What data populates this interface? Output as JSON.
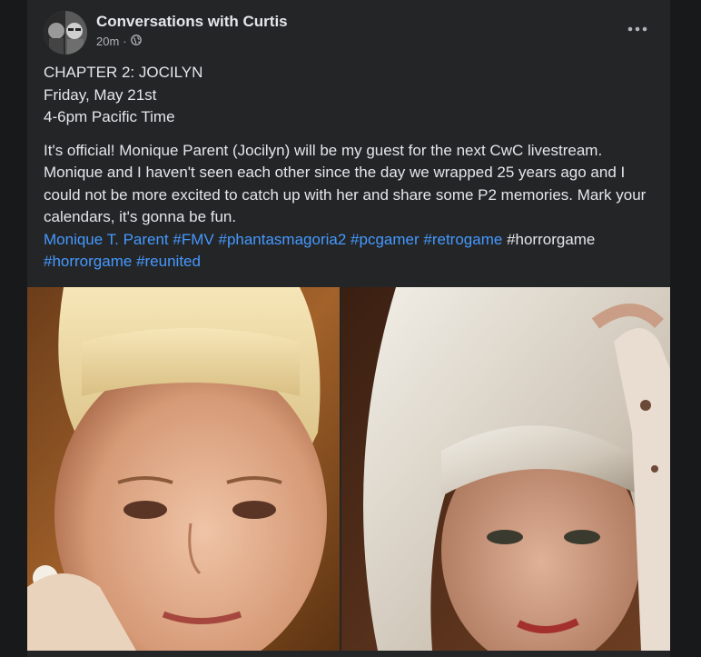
{
  "post": {
    "page_name": "Conversations with Curtis",
    "time": "20m",
    "separator": "·",
    "privacy_icon": "globe-icon",
    "more_icon": "more-options-icon",
    "lines": [
      "CHAPTER 2: JOCILYN",
      "Friday, May 21st",
      "4-6pm Pacific Time"
    ],
    "body": "It's official! Monique Parent (Jocilyn) will be my guest for the next CwC livestream. Monique and I haven't seen each other since the day we wrapped 25 years ago and I could not be more excited to catch up with her and share some P2 memories. Mark your calendars, it's gonna be fun.",
    "tags": [
      {
        "text": "Monique T. Parent",
        "linked": true
      },
      {
        "text": "#FMV",
        "linked": true
      },
      {
        "text": "#phantasmagoria2",
        "linked": true
      },
      {
        "text": "#pcgamer",
        "linked": true
      },
      {
        "text": "#retrogame",
        "linked": true
      },
      {
        "text": "#horrorgame",
        "linked": false
      },
      {
        "text": "#horrorgame",
        "linked": true
      },
      {
        "text": "#reunited",
        "linked": true
      }
    ]
  },
  "colors": {
    "background": "#18191a",
    "card": "#242526",
    "primary_text": "#e4e6eb",
    "secondary_text": "#b0b3b8",
    "link": "#4599ff"
  }
}
